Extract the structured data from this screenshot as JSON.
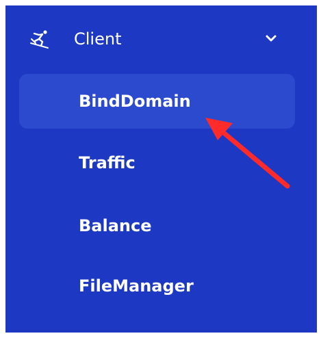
{
  "menu": {
    "group_label": "Client",
    "group_icon": "skier-icon",
    "expand_icon": "chevron-down-icon",
    "items": [
      {
        "label": "BindDomain",
        "active": true
      },
      {
        "label": "Traffic",
        "active": false
      },
      {
        "label": "Balance",
        "active": false
      },
      {
        "label": "FileManager",
        "active": false
      }
    ]
  },
  "colors": {
    "panel_bg": "#1d39c4",
    "active_item_bg": "#2b4acd",
    "text": "#ffffff",
    "annotation_arrow": "#ff2a2a"
  }
}
